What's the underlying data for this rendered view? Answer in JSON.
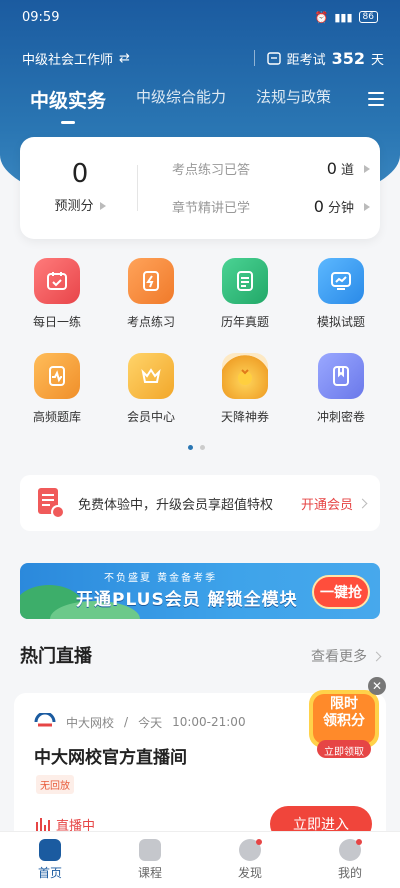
{
  "status": {
    "time": "09:59",
    "battery": "86"
  },
  "topbar": {
    "exam": "中级社会工作师",
    "countdown_label": "距考试",
    "countdown_days": "352",
    "countdown_unit": "天"
  },
  "tabs": [
    {
      "label": "中级实务",
      "active": true
    },
    {
      "label": "中级综合能力",
      "active": false
    },
    {
      "label": "法规与政策",
      "active": false
    }
  ],
  "stats": {
    "score_value": "0",
    "score_label": "预测分",
    "rows": [
      {
        "label": "考点练习已答",
        "value": "0",
        "unit": "道"
      },
      {
        "label": "章节精讲已学",
        "value": "0",
        "unit": "分钟"
      }
    ]
  },
  "grid": [
    {
      "label": "每日一练",
      "icon": "calendar-icon",
      "color": "#f05a5a"
    },
    {
      "label": "考点练习",
      "icon": "bolt-doc-icon",
      "color": "#f28a3c"
    },
    {
      "label": "历年真题",
      "icon": "document-icon",
      "color": "#2fbf7a"
    },
    {
      "label": "模拟试题",
      "icon": "chart-monitor-icon",
      "color": "#3aa0f0"
    },
    {
      "label": "高频题库",
      "icon": "pulse-book-icon",
      "color": "#f5a033"
    },
    {
      "label": "会员中心",
      "icon": "crown-icon",
      "color": "#f5b531"
    },
    {
      "label": "天降神券",
      "icon": "lucky-bag-icon",
      "color": "#f2c24a"
    },
    {
      "label": "冲刺密卷",
      "icon": "sealed-book-icon",
      "color": "#7b8cf5"
    }
  ],
  "vip": {
    "text": "免费体验中，升级会员享超值特权",
    "cta": "开通会员"
  },
  "banner": {
    "sub": "不负盛夏 黄金备考季",
    "main": "开通PLUS会员 解锁全模块",
    "button": "一键抢"
  },
  "live": {
    "section_title": "热门直播",
    "more": "查看更多",
    "school": "中大网校",
    "date": "今天",
    "time": "10:00-21:00",
    "title": "中大网校官方直播间",
    "tag": "无回放",
    "status": "直播中",
    "join": "立即进入"
  },
  "float": {
    "line1": "限时",
    "line2": "领积分",
    "button": "立即领取"
  },
  "nav": [
    {
      "label": "首页",
      "active": true
    },
    {
      "label": "课程",
      "active": false
    },
    {
      "label": "发现",
      "active": false
    },
    {
      "label": "我的",
      "active": false
    }
  ]
}
